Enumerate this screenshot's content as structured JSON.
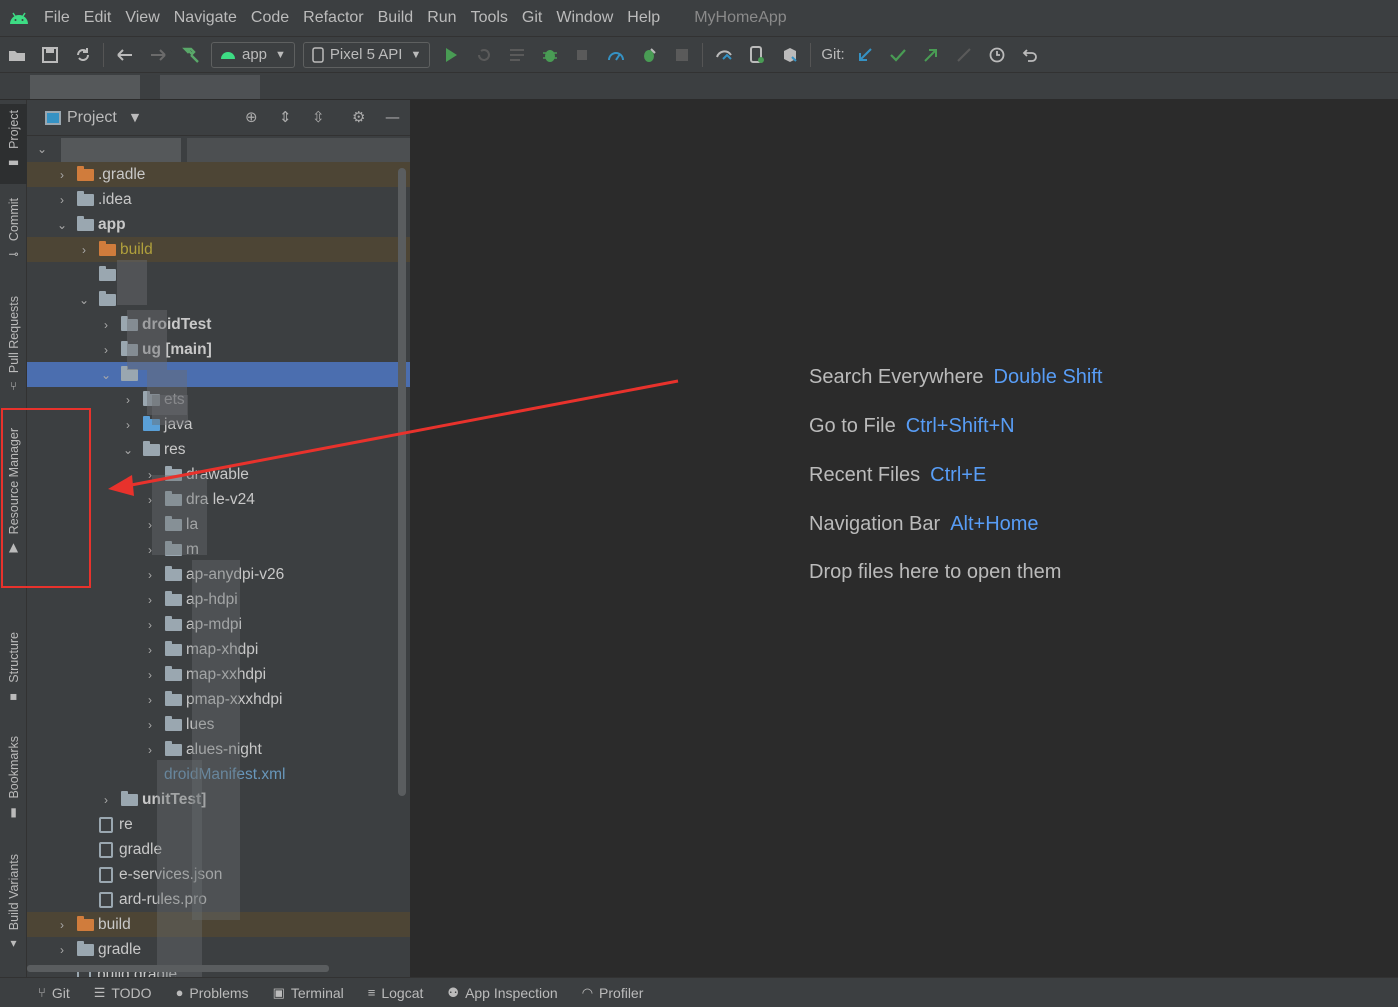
{
  "menubar": {
    "items": [
      "File",
      "Edit",
      "View",
      "Navigate",
      "Code",
      "Refactor",
      "Build",
      "Run",
      "Tools",
      "Git",
      "Window",
      "Help"
    ],
    "project_title": "MyHomeApp"
  },
  "toolbar": {
    "run_config": "app",
    "device": "Pixel 5 API",
    "git_label": "Git:",
    "icons": [
      "open-folder-icon",
      "save-icon",
      "sync-icon",
      "back-icon",
      "forward-icon",
      "hammer-icon",
      "run-icon",
      "rerun-icon",
      "list-icon",
      "debug-icon",
      "attach-icon",
      "profile-icon",
      "apply-changes-icon",
      "stop-icon",
      "sync-gradle-icon",
      "device-manager-icon",
      "sdk-manager-icon",
      "git-update-icon",
      "git-commit-icon",
      "git-push-icon",
      "git-pull-icon",
      "history-icon",
      "rollback-icon"
    ]
  },
  "left_strip": {
    "tabs": [
      "Project",
      "Commit",
      "Pull Requests",
      "Resource Manager",
      "Structure",
      "Bookmarks",
      "Build Variants"
    ]
  },
  "project_panel": {
    "title": "Project",
    "tree": [
      {
        "label": ".gradle",
        "indent": 0,
        "chev": ">",
        "folder": "orange",
        "style": "excluded"
      },
      {
        "label": ".idea",
        "indent": 0,
        "chev": ">",
        "folder": "gray"
      },
      {
        "label": "app",
        "indent": 0,
        "chev": "v",
        "folder": "gray",
        "bold": true
      },
      {
        "label": "build",
        "indent": 1,
        "chev": ">",
        "folder": "orange",
        "style": "excluded",
        "color": "olive"
      },
      {
        "label": "",
        "indent": 1,
        "chev": "",
        "folder": "gray"
      },
      {
        "label": "",
        "indent": 1,
        "chev": "v",
        "folder": "gray"
      },
      {
        "label": "droidTest",
        "indent": 2,
        "chev": ">",
        "folder": "gray",
        "bold": true
      },
      {
        "label": "ug [main]",
        "indent": 2,
        "chev": ">",
        "folder": "gray",
        "bold": true
      },
      {
        "label": "",
        "indent": 2,
        "chev": "v",
        "folder": "gray",
        "style": "sel"
      },
      {
        "label": "ets",
        "indent": 3,
        "chev": ">",
        "folder": "gray"
      },
      {
        "label": "java",
        "indent": 3,
        "chev": ">",
        "folder": "blue"
      },
      {
        "label": "res",
        "indent": 3,
        "chev": "v",
        "folder": "gray"
      },
      {
        "label": "drawable",
        "indent": 4,
        "chev": ">",
        "folder": "gray"
      },
      {
        "label": "dra le-v24",
        "indent": 4,
        "chev": ">",
        "folder": "gray"
      },
      {
        "label": "la",
        "indent": 4,
        "chev": ">",
        "folder": "gray"
      },
      {
        "label": "m",
        "indent": 4,
        "chev": ">",
        "folder": "gray"
      },
      {
        "label": "ap-anydpi-v26",
        "indent": 4,
        "chev": ">",
        "folder": "gray"
      },
      {
        "label": "ap-hdpi",
        "indent": 4,
        "chev": ">",
        "folder": "gray"
      },
      {
        "label": "ap-mdpi",
        "indent": 4,
        "chev": ">",
        "folder": "gray"
      },
      {
        "label": "map-xhdpi",
        "indent": 4,
        "chev": ">",
        "folder": "gray"
      },
      {
        "label": "map-xxhdpi",
        "indent": 4,
        "chev": ">",
        "folder": "gray"
      },
      {
        "label": "pmap-xxxhdpi",
        "indent": 4,
        "chev": ">",
        "folder": "gray"
      },
      {
        "label": "lues",
        "indent": 4,
        "chev": ">",
        "folder": "gray"
      },
      {
        "label": "alues-night",
        "indent": 4,
        "chev": ">",
        "folder": "gray"
      },
      {
        "label": "droidManifest.xml",
        "indent": 3,
        "chev": "",
        "folder": "none",
        "color": "link"
      },
      {
        "label": "unitTest]",
        "indent": 2,
        "chev": ">",
        "folder": "gray",
        "bold": true
      },
      {
        "label": "re",
        "indent": 1,
        "chev": "",
        "folder": "file"
      },
      {
        "label": "gradle",
        "indent": 1,
        "chev": "",
        "folder": "file"
      },
      {
        "label": "e-services.json",
        "indent": 1,
        "chev": "",
        "folder": "file"
      },
      {
        "label": "ard-rules.pro",
        "indent": 1,
        "chev": "",
        "folder": "file"
      },
      {
        "label": "build",
        "indent": 0,
        "chev": ">",
        "folder": "orange",
        "style": "excluded"
      },
      {
        "label": "gradle",
        "indent": 0,
        "chev": ">",
        "folder": "gray"
      },
      {
        "label": "build.gradle",
        "indent": 0,
        "chev": "",
        "folder": "file"
      }
    ]
  },
  "editor": {
    "hints": [
      {
        "label": "Search Everywhere",
        "shortcut": "Double Shift"
      },
      {
        "label": "Go to File",
        "shortcut": "Ctrl+Shift+N"
      },
      {
        "label": "Recent Files",
        "shortcut": "Ctrl+E"
      },
      {
        "label": "Navigation Bar",
        "shortcut": "Alt+Home"
      },
      {
        "label": "Drop files here to open them",
        "shortcut": ""
      }
    ]
  },
  "bottombar": {
    "tabs": [
      "Git",
      "TODO",
      "Problems",
      "Terminal",
      "Logcat",
      "App Inspection",
      "Profiler"
    ]
  },
  "colors": {
    "accent": "#589df6",
    "selection": "#4b6eaf",
    "highlight_box": "#e8322c",
    "excluded_folder": "#d07c3c"
  }
}
